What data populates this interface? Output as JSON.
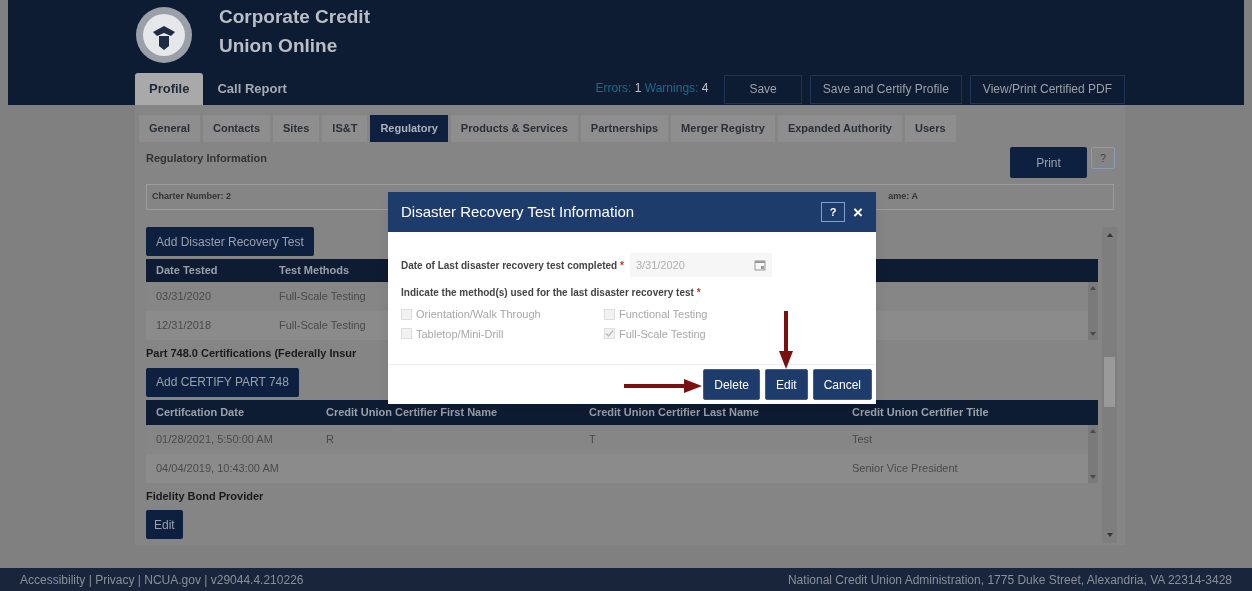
{
  "header": {
    "title_line_1": "Corporate Credit",
    "title_line_2": "Union Online"
  },
  "top_tabs": [
    {
      "label": "Profile",
      "selected": true
    },
    {
      "label": "Call Report",
      "selected": false
    }
  ],
  "status": {
    "errors_label": "Errors:",
    "errors": "1",
    "warnings_label": "Warnings:",
    "warnings": "4"
  },
  "top_buttons": [
    "Save",
    "Save and Certify Profile",
    "View/Print Certified PDF"
  ],
  "tabs": [
    {
      "label": "General",
      "selected": false
    },
    {
      "label": "Contacts",
      "selected": false
    },
    {
      "label": "Sites",
      "selected": false
    },
    {
      "label": "IS&T",
      "selected": false
    },
    {
      "label": "Regulatory",
      "selected": true
    },
    {
      "label": "Products & Services",
      "selected": false
    },
    {
      "label": "Partnerships",
      "selected": false
    },
    {
      "label": "Merger Registry",
      "selected": false
    },
    {
      "label": "Expanded Authority",
      "selected": false
    },
    {
      "label": "Users",
      "selected": false
    }
  ],
  "section_title": "Regulatory Information",
  "print_button": "Print",
  "help_button": "?",
  "charter_field": {
    "left": "Charter Number: 2",
    "right": "ame: A"
  },
  "dr_section": {
    "add_button": "Add Disaster Recovery Test",
    "columns": [
      "Date Tested",
      "Test Methods"
    ],
    "rows": [
      [
        "03/31/2020",
        "Full-Scale Testing"
      ],
      [
        "12/31/2018",
        "Full-Scale Testing"
      ]
    ]
  },
  "cert_section": {
    "heading": "Part 748.0 Certifications (Federally Insur",
    "add_button": "Add CERTIFY PART 748",
    "columns": [
      "Certifcation Date",
      "Credit Union Certifier First Name",
      "Credit Union Certifier Last Name",
      "Credit Union Certifier Title"
    ],
    "rows": [
      {
        "certification_date": "01/28/2021, 5:50:00 AM",
        "first_name": "R",
        "last_name": "T",
        "title": "Test"
      },
      {
        "certification_date": "04/04/2019, 10:43:00 AM",
        "title": "Senior Vice President"
      }
    ]
  },
  "fidelity_section": {
    "heading": "Fidelity Bond Provider",
    "edit_button": "Edit"
  },
  "modal": {
    "title": "Disaster Recovery Test Information",
    "help_button": "?",
    "close": "×",
    "date_label": "Date of Last disaster recovery test completed",
    "date_required": "*",
    "date_value": "3/31/2020",
    "methods_label": "Indicate the method(s) used for the last disaster recovery test",
    "methods_required": "*",
    "methods": [
      {
        "label": "Orientation/Walk Through",
        "checked": false,
        "disabled": true
      },
      {
        "label": "Functional Testing",
        "checked": false,
        "disabled": true
      },
      {
        "label": "Tabletop/Mini-Drill",
        "checked": false,
        "disabled": true
      },
      {
        "label": "Full-Scale Testing",
        "checked": true,
        "disabled": true
      }
    ],
    "buttons": [
      "Delete",
      "Edit",
      "Cancel"
    ]
  },
  "footer": {
    "left": "Accessibility | Privacy | NCUA.gov | v29044.4.210226",
    "right": "National Credit Union Administration, 1775 Duke Street, Alexandria, VA 22314-3428"
  }
}
